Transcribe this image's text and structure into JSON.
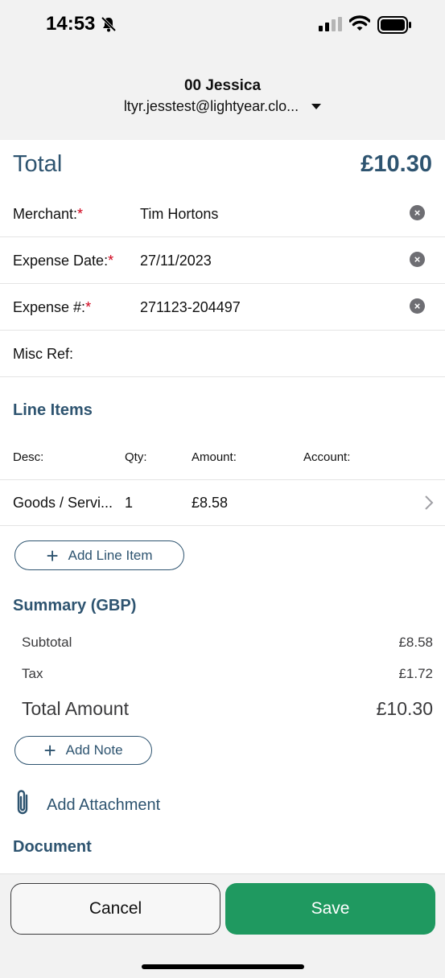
{
  "status_bar": {
    "time": "14:53"
  },
  "account": {
    "name": "00 Jessica",
    "email": "ltyr.jesstest@lightyear.clo..."
  },
  "total": {
    "label": "Total",
    "value": "£10.30"
  },
  "fields": {
    "merchant": {
      "label": "Merchant:",
      "required_mark": "*",
      "value": "Tim Hortons"
    },
    "expense_date": {
      "label": "Expense Date:",
      "required_mark": "*",
      "value": "27/11/2023"
    },
    "expense_number": {
      "label": "Expense #:",
      "required_mark": "*",
      "value": "271123-204497"
    },
    "misc_ref": {
      "label": "Misc Ref:",
      "value": ""
    }
  },
  "line_items": {
    "title": "Line Items",
    "columns": {
      "desc": "Desc:",
      "qty": "Qty:",
      "amount": "Amount:",
      "account": "Account:"
    },
    "rows": [
      {
        "desc": "Goods / Servi...",
        "qty": "1",
        "amount": "£8.58",
        "account": ""
      }
    ],
    "add_label": "Add Line Item"
  },
  "summary": {
    "title": "Summary (GBP)",
    "subtotal_label": "Subtotal",
    "subtotal_value": "£8.58",
    "tax_label": "Tax",
    "tax_value": "£1.72",
    "total_label": "Total Amount",
    "total_value": "£10.30",
    "add_note_label": "Add Note"
  },
  "attachment": {
    "label": "Add Attachment"
  },
  "document": {
    "title": "Document"
  },
  "actions": {
    "cancel_label": "Cancel",
    "save_label": "Save"
  },
  "colors": {
    "accent": "#2e5470",
    "save": "#1f9960",
    "required": "#d0021b"
  }
}
